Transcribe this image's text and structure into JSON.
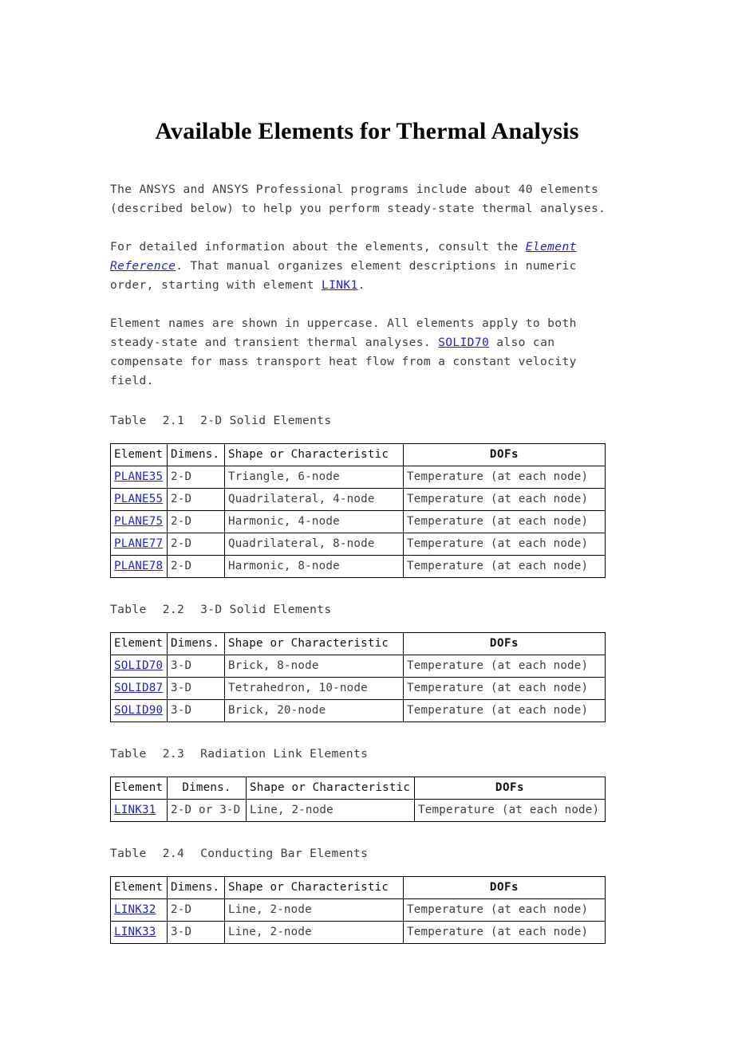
{
  "document": {
    "title": "Available Elements for Thermal Analysis",
    "paragraphs": {
      "p1_a": "The ANSYS and ANSYS Professional programs include about 40 elements (described below) to help you perform steady-state thermal analyses.",
      "p2_a": "For detailed information about the elements, consult the ",
      "p2_link1": "Element Reference",
      "p2_b": ". That manual organizes element descriptions in numeric order, starting with element ",
      "p2_link2": "LINK1",
      "p2_c": ".",
      "p3_a": "Element names are shown in uppercase. All elements apply to both steady-state and transient thermal analyses. ",
      "p3_link1": "SOLID70",
      "p3_b": " also can compensate for mass transport heat flow from a constant velocity field."
    }
  },
  "tables": [
    {
      "caption_label": "Table",
      "caption_number": "2.1",
      "caption_title": "2-D Solid Elements",
      "headers": [
        "Element",
        "Dimens.",
        "Shape or Characteristic",
        "DOFs"
      ],
      "rows": [
        {
          "element": "PLANE35",
          "dimens": "2-D",
          "shape": "Triangle, 6-node",
          "dofs": "Temperature (at each node)"
        },
        {
          "element": "PLANE55",
          "dimens": "2-D",
          "shape": "Quadrilateral, 4-node",
          "dofs": "Temperature (at each node)"
        },
        {
          "element": "PLANE75",
          "dimens": "2-D",
          "shape": "Harmonic, 4-node",
          "dofs": "Temperature (at each node)"
        },
        {
          "element": "PLANE77",
          "dimens": "2-D",
          "shape": "Quadrilateral, 8-node",
          "dofs": "Temperature (at each node)"
        },
        {
          "element": "PLANE78",
          "dimens": "2-D",
          "shape": "Harmonic, 8-node",
          "dofs": "Temperature (at each node)"
        }
      ]
    },
    {
      "caption_label": "Table",
      "caption_number": "2.2",
      "caption_title": "3-D Solid Elements",
      "headers": [
        "Element",
        "Dimens.",
        "Shape or Characteristic",
        "DOFs"
      ],
      "rows": [
        {
          "element": "SOLID70",
          "dimens": "3-D",
          "shape": "Brick, 8-node",
          "dofs": "Temperature (at each node)"
        },
        {
          "element": "SOLID87",
          "dimens": "3-D",
          "shape": "Tetrahedron, 10-node",
          "dofs": "Temperature (at each node)"
        },
        {
          "element": "SOLID90",
          "dimens": "3-D",
          "shape": "Brick, 20-node",
          "dofs": "Temperature (at each node)"
        }
      ]
    },
    {
      "caption_label": "Table",
      "caption_number": "2.3",
      "caption_title": "Radiation Link Elements",
      "headers": [
        "Element",
        "Dimens.",
        "Shape or Characteristic",
        "DOFs"
      ],
      "rows": [
        {
          "element": "LINK31",
          "dimens": "2-D or 3-D",
          "shape": "Line, 2-node",
          "dofs": "Temperature (at each node)"
        }
      ]
    },
    {
      "caption_label": "Table",
      "caption_number": "2.4",
      "caption_title": "Conducting Bar Elements",
      "headers": [
        "Element",
        "Dimens.",
        "Shape or Characteristic",
        "DOFs"
      ],
      "rows": [
        {
          "element": "LINK32",
          "dimens": "2-D",
          "shape": "Line, 2-node",
          "dofs": "Temperature (at each node)"
        },
        {
          "element": "LINK33",
          "dimens": "3-D",
          "shape": "Line, 2-node",
          "dofs": "Temperature (at each node)"
        }
      ]
    }
  ],
  "colors": {
    "link": "#2222CC",
    "text": "#3D3D3D",
    "border": "#000000",
    "background": "#FFFFFF"
  }
}
